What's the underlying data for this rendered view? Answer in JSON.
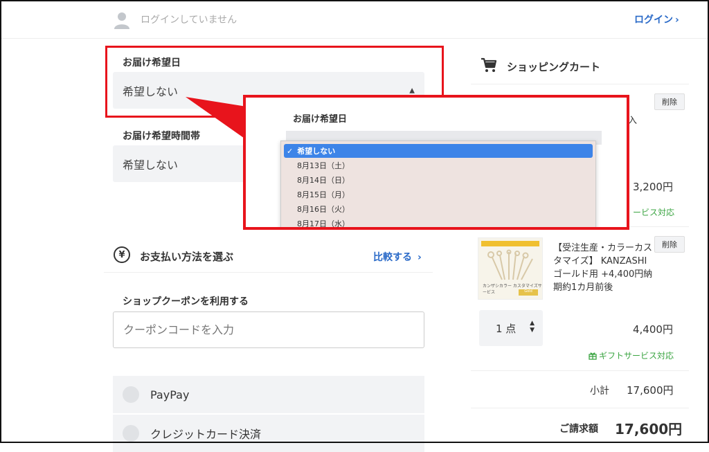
{
  "header": {
    "login_status": "ログインしていません",
    "login_link": "ログイン"
  },
  "delivery": {
    "date_label": "お届け希望日",
    "date_value": "希望しない",
    "time_label": "お届け希望時間帯",
    "time_value": "希望しない"
  },
  "popup": {
    "label": "お届け希望日",
    "options": [
      "希望しない",
      "8月13日（土）",
      "8月14日（日）",
      "8月15日（月）",
      "8月16日（火）",
      "8月17日（水）"
    ],
    "selected_index": 0
  },
  "payment": {
    "title": "お支払い方法を選ぶ",
    "compare_link": "比較する",
    "coupon_label": "ショップクーポンを利用する",
    "coupon_placeholder": "クーポンコードを入力",
    "options": [
      "PayPay",
      "クレジットカード決済"
    ]
  },
  "cart": {
    "title": "ショッピングカート",
    "item1": {
      "delete_label": "削除",
      "name_fragment": "入",
      "price": "3,200円",
      "gift_fragment": "ービス対応"
    },
    "item2": {
      "delete_label": "削除",
      "name": "【受注生産・カラーカスタマイズ】 KANZASHI ゴールド用 +4,400円納期約1カ月前後",
      "thumb_text": "カンザシカラー\nカスタマイズサービス",
      "thumb_badge": "Gold",
      "quantity": "1 点",
      "price": "4,400円",
      "gift_note": "ギフトサービス対応"
    },
    "subtotal_label": "小計",
    "subtotal_value": "17,600円",
    "total_label": "ご請求額",
    "total_value": "17,600円"
  },
  "colors": {
    "accent_red": "#e8141c",
    "link_blue": "#2a6ac8",
    "gift_green": "#3aa441",
    "selected_blue": "#3d84e8"
  }
}
